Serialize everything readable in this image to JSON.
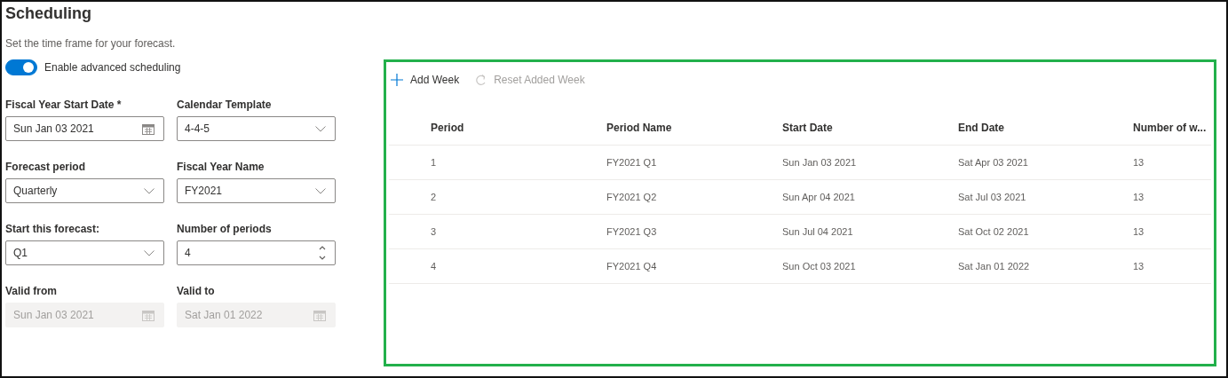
{
  "title": "Scheduling",
  "subtitle": "Set the time frame for your forecast.",
  "toggle": {
    "label": "Enable advanced scheduling",
    "on": true
  },
  "fields": [
    {
      "label": "Fiscal Year Start Date *",
      "value": "Sun Jan 03 2021",
      "kind": "date",
      "disabled": false
    },
    {
      "label": "Calendar Template",
      "value": "4-4-5",
      "kind": "select",
      "disabled": false
    },
    {
      "label": "Forecast period",
      "value": "Quarterly",
      "kind": "select",
      "disabled": false
    },
    {
      "label": "Fiscal Year Name",
      "value": "FY2021",
      "kind": "select",
      "disabled": false
    },
    {
      "label": "Start this forecast:",
      "value": "Q1",
      "kind": "select",
      "disabled": false
    },
    {
      "label": "Number of periods",
      "value": "4",
      "kind": "number",
      "disabled": false
    },
    {
      "label": "Valid from",
      "value": "Sun Jan 03 2021",
      "kind": "date",
      "disabled": true
    },
    {
      "label": "Valid to",
      "value": "Sat Jan 01 2022",
      "kind": "date",
      "disabled": true
    }
  ],
  "toolbar": [
    {
      "label": "Add Week",
      "kind": "add",
      "disabled": false
    },
    {
      "label": "Reset Added Week",
      "kind": "reset",
      "disabled": true
    }
  ],
  "table": {
    "columns": [
      "Period",
      "Period Name",
      "Start Date",
      "End Date",
      "Number of w..."
    ],
    "rows": [
      [
        "1",
        "FY2021 Q1",
        "Sun Jan 03 2021",
        "Sat Apr 03 2021",
        "13"
      ],
      [
        "2",
        "FY2021 Q2",
        "Sun Apr 04 2021",
        "Sat Jul 03 2021",
        "13"
      ],
      [
        "3",
        "FY2021 Q3",
        "Sun Jul 04 2021",
        "Sat Oct 02 2021",
        "13"
      ],
      [
        "4",
        "FY2021 Q4",
        "Sun Oct 03 2021",
        "Sat Jan 01 2022",
        "13"
      ]
    ]
  }
}
